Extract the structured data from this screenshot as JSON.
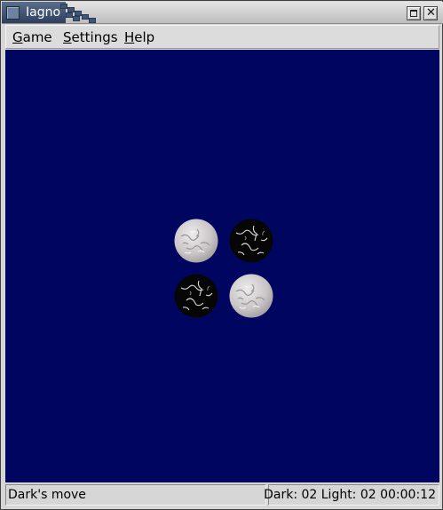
{
  "window": {
    "title": "Iagno"
  },
  "menubar": {
    "items": [
      {
        "label": "Game",
        "mnemonic": "G",
        "rest": "ame"
      },
      {
        "label": "Settings",
        "mnemonic": "S",
        "rest": "ettings"
      },
      {
        "label": "Help",
        "mnemonic": "H",
        "rest": "elp"
      }
    ]
  },
  "board": {
    "background_color": "#000660",
    "pieces": [
      {
        "position": "d4",
        "color": "light"
      },
      {
        "position": "e4",
        "color": "dark"
      },
      {
        "position": "d5",
        "color": "dark"
      },
      {
        "position": "e5",
        "color": "light"
      }
    ]
  },
  "status": {
    "message": "Dark's move",
    "score": "Dark: 02 Light: 02 00:00:12"
  }
}
